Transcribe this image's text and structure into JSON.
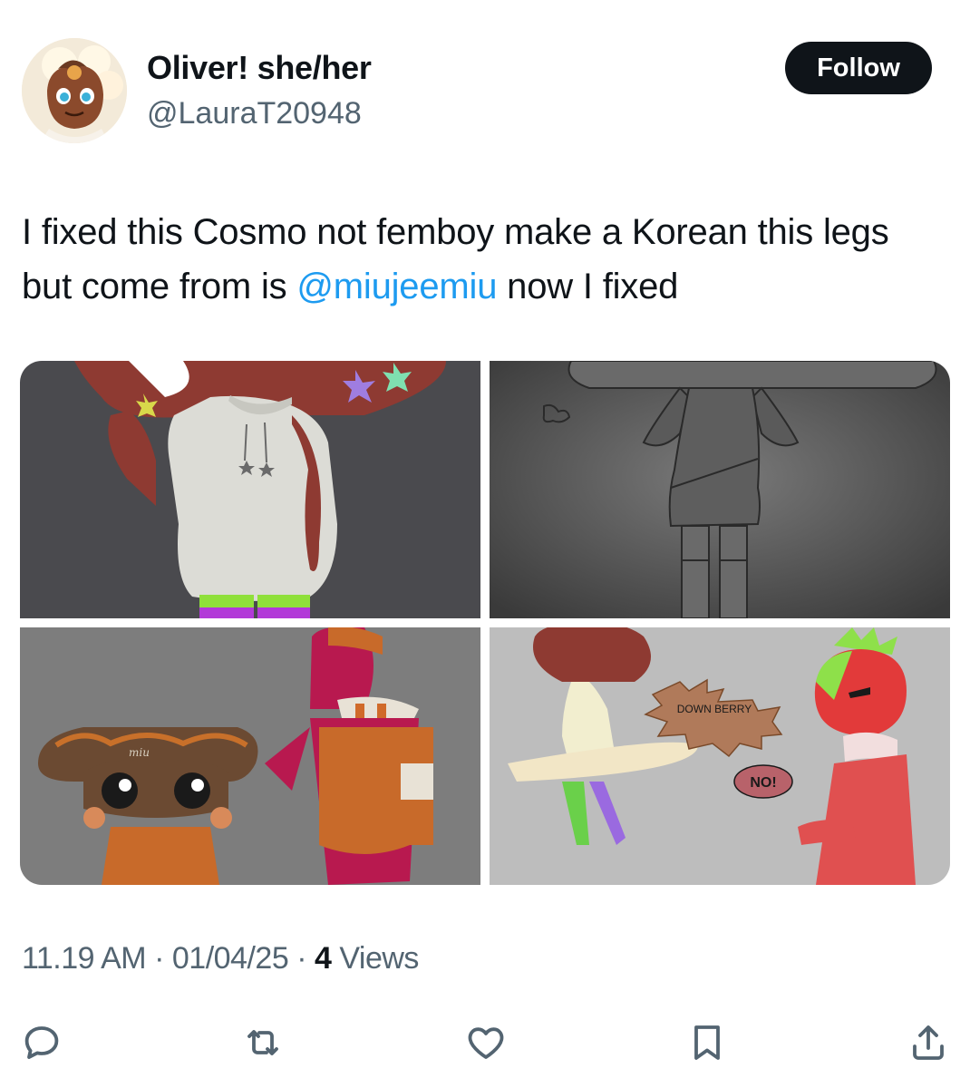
{
  "author": {
    "display_name": "Oliver! she/her",
    "handle": "@LauraT20948",
    "avatar_icon": "avatar-cookie-character"
  },
  "follow_label": "Follow",
  "tweet": {
    "text_before": "I fixed this Cosmo not femboy make a Korean this legs but come from is ",
    "mention": "@miujeemiu",
    "text_after": " now I fixed"
  },
  "media": {
    "count": 4,
    "images": [
      {
        "position": "top-left",
        "description_icon": "artwork-hoodie-character"
      },
      {
        "position": "top-right",
        "description_icon": "artwork-sketch-character"
      },
      {
        "position": "bottom-left",
        "description_icon": "artwork-two-characters",
        "signature": "miu"
      },
      {
        "position": "bottom-right",
        "description_icon": "artwork-comic-panel",
        "speech_1": "DOWN BERRY",
        "speech_2": "NO!"
      }
    ]
  },
  "meta": {
    "time": "11.19 AM",
    "separator": "·",
    "date": "01/04/25",
    "views_count": "4",
    "views_label": "Views"
  },
  "actions": [
    {
      "name": "reply",
      "icon": "reply-icon"
    },
    {
      "name": "repost",
      "icon": "repost-icon"
    },
    {
      "name": "like",
      "icon": "heart-icon"
    },
    {
      "name": "bookmark",
      "icon": "bookmark-icon"
    },
    {
      "name": "share",
      "icon": "share-icon"
    }
  ],
  "colors": {
    "text": "#0f1419",
    "secondary": "#536471",
    "link": "#1d9bf0",
    "follow_bg": "#0f1419"
  }
}
